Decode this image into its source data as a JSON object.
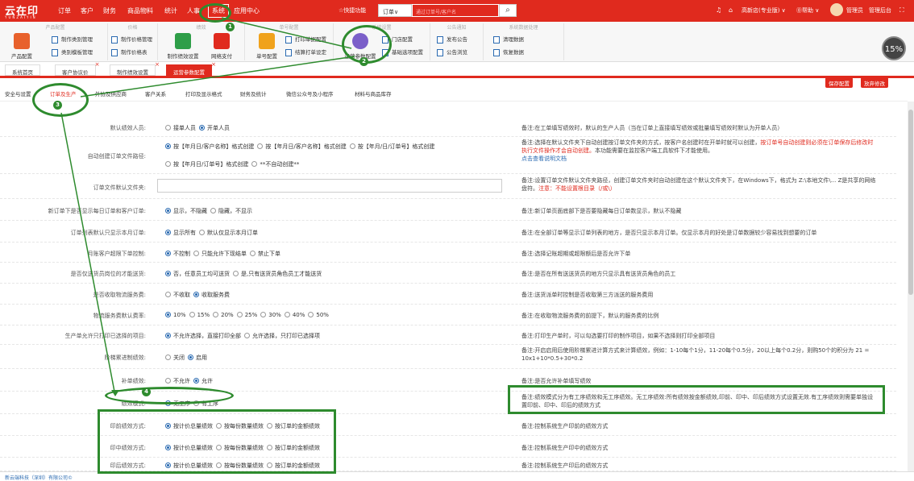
{
  "app": {
    "logo": "云在印",
    "logo_sub": "YUNZAIYIN",
    "nav": [
      "订单",
      "客户",
      "财务",
      "商品物料",
      "统计",
      "人事",
      "系统",
      "应用中心"
    ],
    "quick": "☆快捷功能",
    "order_select": "订单∨",
    "order_placeholder": "通过订单号/客户名",
    "user_company": "高新店(专业版) ∨",
    "help": "⓪帮助 ∨",
    "admin": "管理员",
    "admin_back": "管理后台"
  },
  "ribbon": {
    "groups": [
      "产品配置",
      "价格",
      "绩效",
      "单号配置",
      "系统设置",
      "公告通知",
      "系统数据处理"
    ],
    "items": {
      "product_config": "产品配置",
      "type_mgmt": "制作类别管理",
      "module_mgmt": "类别模板管理",
      "price_mgmt": "制作价格管理",
      "price_table": "制作价格表",
      "perf_setting": "制作绩效设置",
      "online_pay": "网络支付",
      "order_config": "单号配置",
      "print_config": "打印单据配置",
      "settle_print": "结算打单设定",
      "op_params": "运营参数配置",
      "shop_config": "门店配置",
      "basic_options": "基础选项配置",
      "publish_notice": "发布公告",
      "notice_browse": "公告浏览",
      "clean_data": "清理数据",
      "restore_data": "恢复数据"
    }
  },
  "progress": "15%",
  "tabs": [
    "系统首页",
    "客户协议价",
    "制作绩效设置",
    "运营参数配置"
  ],
  "buttons": {
    "save": "保存配置",
    "discard": "放弃修改"
  },
  "subtabs": [
    "安全与设置",
    "订单及生产",
    "外协及供应商",
    "客户关系",
    "打印及显示格式",
    "财务及统计",
    "微信公众号及小程序",
    "材料与商品库存"
  ],
  "rows": [
    {
      "label": "默认绩效人员:",
      "opts": [
        "接单人员",
        "开单人员"
      ],
      "on": 1,
      "note": "备注:在工单填写绩效时，默认的生产人员（当在订单上直接填写绩效或批量填写绩效时默认为开单人员）"
    },
    {
      "label": "自动创建订单文件路径:",
      "opts": [
        "按【年月日/客户名称】格式创建",
        "按【年月日/客户名称】格式创建",
        "按【年月/日/订单号】格式创建"
      ],
      "on": 0,
      "opts2": [
        "按【年月日/订单号】格式创建",
        "**不自动创建**"
      ],
      "note": "备注:选择在默认文件夹下自动创建按订单文件夹的方式，按客户名创建时在开单时就可以创建，",
      "note_warn": "按订单号自动创建则必须在订单保存后修改时执行文件操作才会自动创建。",
      "note_tail": "本功能需要在监控客户端工具软件下才能使用。",
      "note_link": "点击查看说明文档"
    },
    {
      "label": "订单文件默认文件夹:",
      "input": "",
      "note": "备注:设置订单文件默认文件夹路径，创建订单文件夹时自动创建在这个默认文件夹下，在Windows下，格式为 Z:\\本地文件\\... Z是共享的网络盘符。",
      "note_warn": "注意：不能设置根目录（/或\\）"
    },
    {
      "label": "新订单下是否显示每日订单和客户订单:",
      "opts": [
        "显示，不隐藏",
        "隐藏，不显示"
      ],
      "on": 0,
      "note": "备注:新订单页面底部下是否要隐藏每日订单数显示，默认不隐藏"
    },
    {
      "label": "订单列表默认只显示本月订单:",
      "opts": [
        "显示所有",
        "默认仅显示本月订单"
      ],
      "on": 0,
      "note": "备注:在全部订单等显示订单列表的地方，是否只显示本月订单。仅显示本月的好处是订单数据较少容易找到想要的订单"
    },
    {
      "label": "月账客户超限下单控制:",
      "opts": [
        "不控制",
        "只能允许下现结单",
        "禁止下单"
      ],
      "on": 0,
      "note": "备注:选择记账超期或超限额后是否允许下单"
    },
    {
      "label": "是否仅送货员岗位的才能送货:",
      "opts": [
        "否，任意员工均可送货",
        "是,只有送货员角色员工才能送货"
      ],
      "on": 0,
      "note": "备注:是否在所有送送货员的地方只显示具有送货员角色的员工"
    },
    {
      "label": "是否收取物流服务费:",
      "opts": [
        "不收取",
        "收取服务费"
      ],
      "on": 1,
      "note": "备注:送货派单时控制是否收取第三方派送的服务费用"
    },
    {
      "label": "物流服务费默认费率:",
      "opts": [
        "10%",
        "15%",
        "20%",
        "25%",
        "30%",
        "40%",
        "50%"
      ],
      "on": 0,
      "note": "备注:在收取物流服务费的前提下，默认的服务费的比例"
    },
    {
      "label": "生产单允许只打印已选择的项目:",
      "opts": [
        "不允许选择，直接打印全部",
        "允许选择，只打印已选择项"
      ],
      "on": 0,
      "note": "备注:打印生产单时，可以勾选要打印的制作项目，如果不选择则打印全部项目"
    },
    {
      "label": "阶梯累进制绩效:",
      "opts": [
        "关闭",
        "启用"
      ],
      "on": 1,
      "note": "备注:开启启用后使用阶梯累进计算方式来计算绩效，例如：1-10每个1分，11-20每个0.5分，20以上每个0.2分，则购50个的积分为 21 = 10x1+10*0.5+30*0.2"
    },
    {
      "label": "补单绩效:",
      "opts": [
        "不允许",
        "允许"
      ],
      "on": 1,
      "note": "备注:是否允许补单填写绩效"
    },
    {
      "label": "绩效模式:",
      "opts": [
        "无工序",
        "有工序"
      ],
      "on": 0,
      "note": "备注:绩效模式分为有工序绩效和无工序绩效。无工序绩效:所有绩效按金额绩效,印前、印中、印后绩效方式设置无效.有工序绩效则需要单独设置印前、印中、印后的绩效方式"
    },
    {
      "label": "印前绩效方式:",
      "opts": [
        "按计价总量绩效",
        "按每份数量绩效",
        "按订单的金额绩效"
      ],
      "on": 0,
      "note": "备注:控制系统生产印前的绩效方式"
    },
    {
      "label": "印中绩效方式:",
      "opts": [
        "按计价总量绩效",
        "按每份数量绩效",
        "按订单的金额绩效"
      ],
      "on": 0,
      "note": "备注:控制系统生产印中的绩效方式"
    },
    {
      "label": "印后绩效方式:",
      "opts": [
        "按计价总量绩效",
        "按每份数量绩效",
        "按订单的金额绩效"
      ],
      "on": 0,
      "note": "备注:控制系统生产印后的绩效方式"
    }
  ],
  "annotations": [
    "1",
    "2",
    "3",
    "4"
  ],
  "footer": "新云端科技（深圳）有限公司©"
}
